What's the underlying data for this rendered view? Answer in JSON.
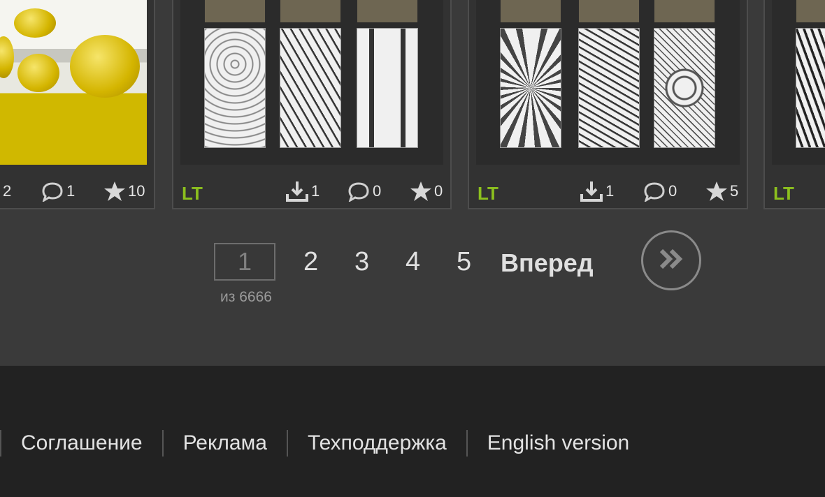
{
  "cards": [
    {
      "stats": {
        "downloads": "2",
        "comments": "1",
        "rating": "10"
      }
    },
    {
      "badge": "LT",
      "stats": {
        "downloads": "1",
        "comments": "0",
        "rating": "0"
      }
    },
    {
      "badge": "LT",
      "stats": {
        "downloads": "1",
        "comments": "0",
        "rating": "5"
      }
    },
    {
      "badge": "LT"
    }
  ],
  "pagination": {
    "current_page": "1",
    "total_text": "из 6666",
    "pages": [
      "2",
      "3",
      "4",
      "5"
    ],
    "next_label": "Вперед"
  },
  "footer": {
    "links": [
      "Соглашение",
      "Реклама",
      "Техподдержка",
      "English version"
    ]
  },
  "colors": {
    "accent_green": "#8cc01e",
    "background": "#3a3a3a",
    "footer": "#222222"
  },
  "icons": {
    "download": "download-icon",
    "comment": "comment-icon",
    "star": "star-icon",
    "next": "double-chevron-right-icon"
  }
}
